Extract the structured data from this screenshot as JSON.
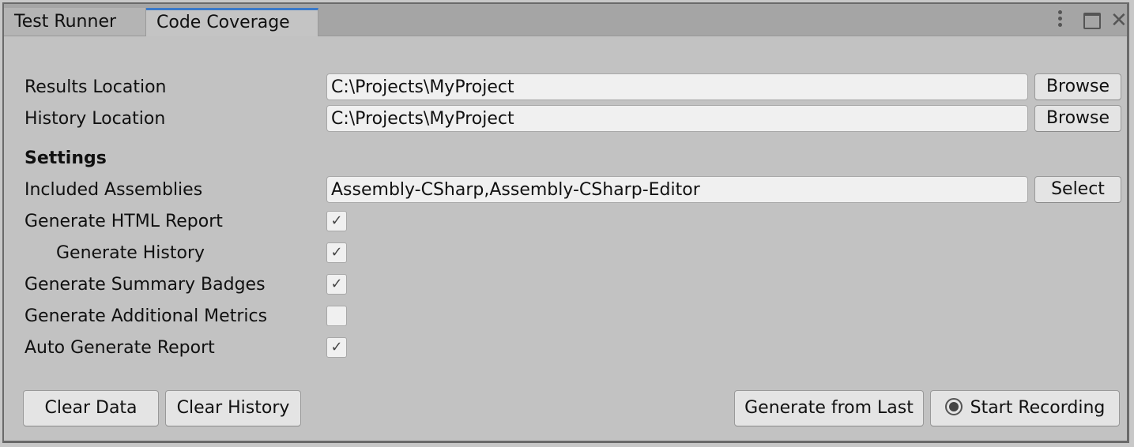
{
  "tabs": [
    {
      "label": "Test Runner",
      "active": false
    },
    {
      "label": "Code Coverage",
      "active": true
    }
  ],
  "window_controls": {
    "menu": "kebab-menu-icon",
    "maximize": "maximize-icon",
    "close": "close-icon",
    "close_glyph": "✕"
  },
  "paths": {
    "results_label": "Results Location",
    "results_value": "C:\\Projects\\MyProject",
    "history_label": "History Location",
    "history_value": "C:\\Projects\\MyProject",
    "browse_label": "Browse"
  },
  "settings": {
    "heading": "Settings",
    "assemblies_label": "Included Assemblies",
    "assemblies_value": "Assembly-CSharp,Assembly-CSharp-Editor",
    "select_label": "Select",
    "options": [
      {
        "label": "Generate HTML Report",
        "checked": true,
        "indent": false
      },
      {
        "label": "Generate History",
        "checked": true,
        "indent": true
      },
      {
        "label": "Generate Summary Badges",
        "checked": true,
        "indent": false
      },
      {
        "label": "Generate Additional Metrics",
        "checked": false,
        "indent": false
      },
      {
        "label": "Auto Generate Report",
        "checked": true,
        "indent": false
      }
    ],
    "check_glyph": "✓"
  },
  "actions": {
    "clear_data": "Clear Data",
    "clear_history": "Clear History",
    "generate_from_last": "Generate from Last",
    "start_recording": "Start Recording"
  },
  "colors": {
    "active_tab_accent": "#3a79c9",
    "panel_bg": "#c2c2c2"
  }
}
